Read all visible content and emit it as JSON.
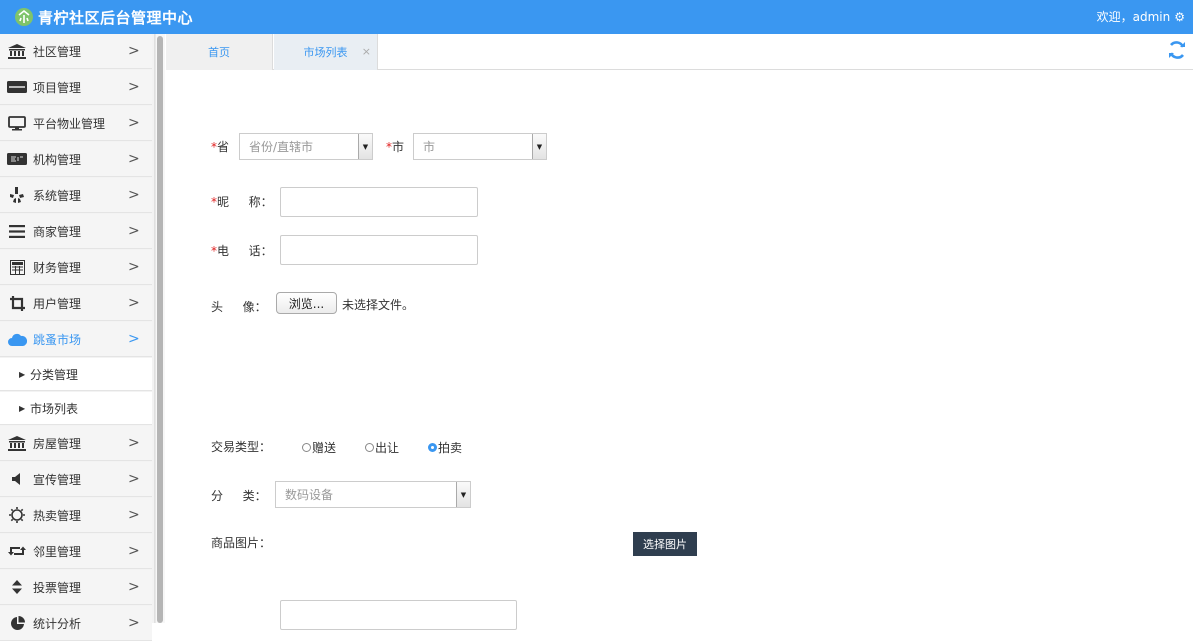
{
  "header": {
    "title": "青柠社区后台管理中心",
    "welcome": "欢迎，admin",
    "logo_icon": "community-logo-icon",
    "settings_icon": "gear-icon",
    "color": "#3a97f1"
  },
  "sidebar": {
    "items": [
      {
        "label": "社区管理",
        "icon": "bank-icon"
      },
      {
        "label": "项目管理",
        "icon": "discover-card-icon"
      },
      {
        "label": "平台物业管理",
        "icon": "monitor-icon"
      },
      {
        "label": "机构管理",
        "icon": "stripe-icon"
      },
      {
        "label": "系统管理",
        "icon": "yelp-icon"
      },
      {
        "label": "商家管理",
        "icon": "bars-icon"
      },
      {
        "label": "财务管理",
        "icon": "calculator-icon"
      },
      {
        "label": "用户管理",
        "icon": "crop-icon"
      },
      {
        "label": "跳蚤市场",
        "icon": "cloud-icon"
      },
      {
        "label": "房屋管理",
        "icon": "bank-icon"
      },
      {
        "label": "宣传管理",
        "icon": "volume-icon"
      },
      {
        "label": "热卖管理",
        "icon": "sun-icon"
      },
      {
        "label": "邻里管理",
        "icon": "retweet-icon"
      },
      {
        "label": "投票管理",
        "icon": "sort-icon"
      },
      {
        "label": "统计分析",
        "icon": "pie-chart-icon"
      }
    ],
    "submenu": [
      {
        "label": "分类管理"
      },
      {
        "label": "市场列表"
      }
    ],
    "chevron": ">"
  },
  "tabs": {
    "home": "首页",
    "market": "市场列表",
    "close": "×"
  },
  "form": {
    "required_mark": "*",
    "province_label": "省",
    "province_placeholder": "省份/直辖市",
    "city_label": "市",
    "city_placeholder": "市",
    "nickname_label": "昵　  称：",
    "phone_label": "电　  话：",
    "avatar_label": "头　  像：",
    "browse_button": "浏览...",
    "no_file": "未选择文件。",
    "trade_type_label": "交易类型：",
    "trade_options": [
      "赠送",
      "出让",
      "拍卖"
    ],
    "trade_selected": "拍卖",
    "category_label": "分　  类：",
    "category_value": "数码设备",
    "product_image_label": "商品图片：",
    "choose_image_button": "选择图片"
  }
}
